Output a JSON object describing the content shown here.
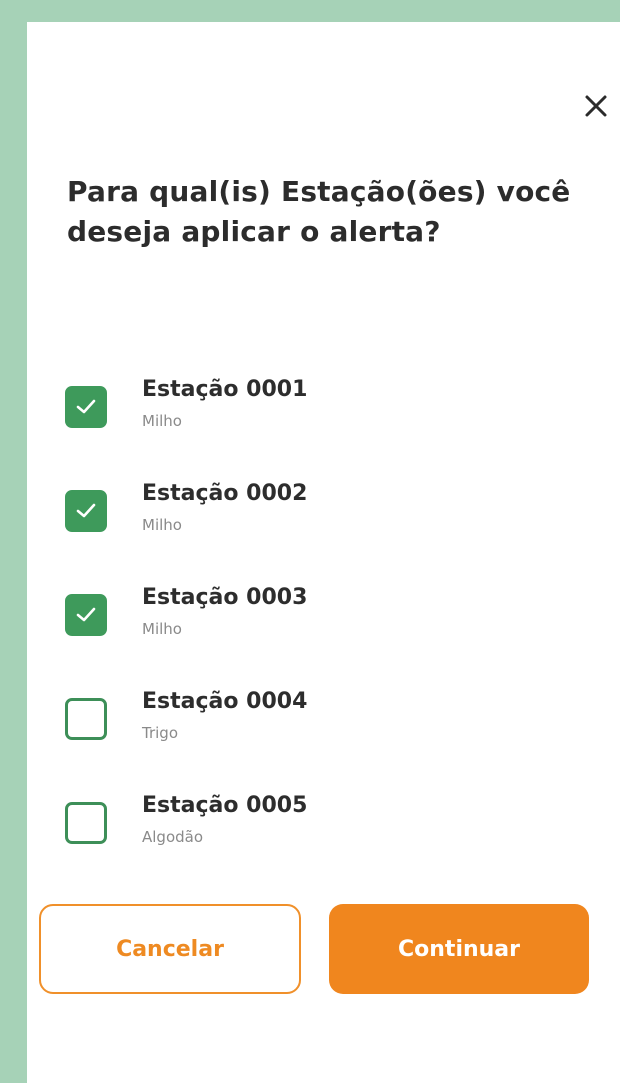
{
  "modal": {
    "title": "Para qual(is) Estação(ões) você deseja aplicar o alerta?",
    "close_icon": "close-icon"
  },
  "stations": [
    {
      "name": "Estação 0001",
      "crop": "Milho",
      "checked": true
    },
    {
      "name": "Estação 0002",
      "crop": "Milho",
      "checked": true
    },
    {
      "name": "Estação 0003",
      "crop": "Milho",
      "checked": true
    },
    {
      "name": "Estação 0004",
      "crop": "Trigo",
      "checked": false
    },
    {
      "name": "Estação 0005",
      "crop": "Algodão",
      "checked": false
    }
  ],
  "buttons": {
    "cancel_label": "Cancelar",
    "continue_label": "Continuar"
  },
  "colors": {
    "page_background": "#a6d2b7",
    "checkbox_green": "#3e9a5b",
    "accent_orange": "#f0861e"
  }
}
